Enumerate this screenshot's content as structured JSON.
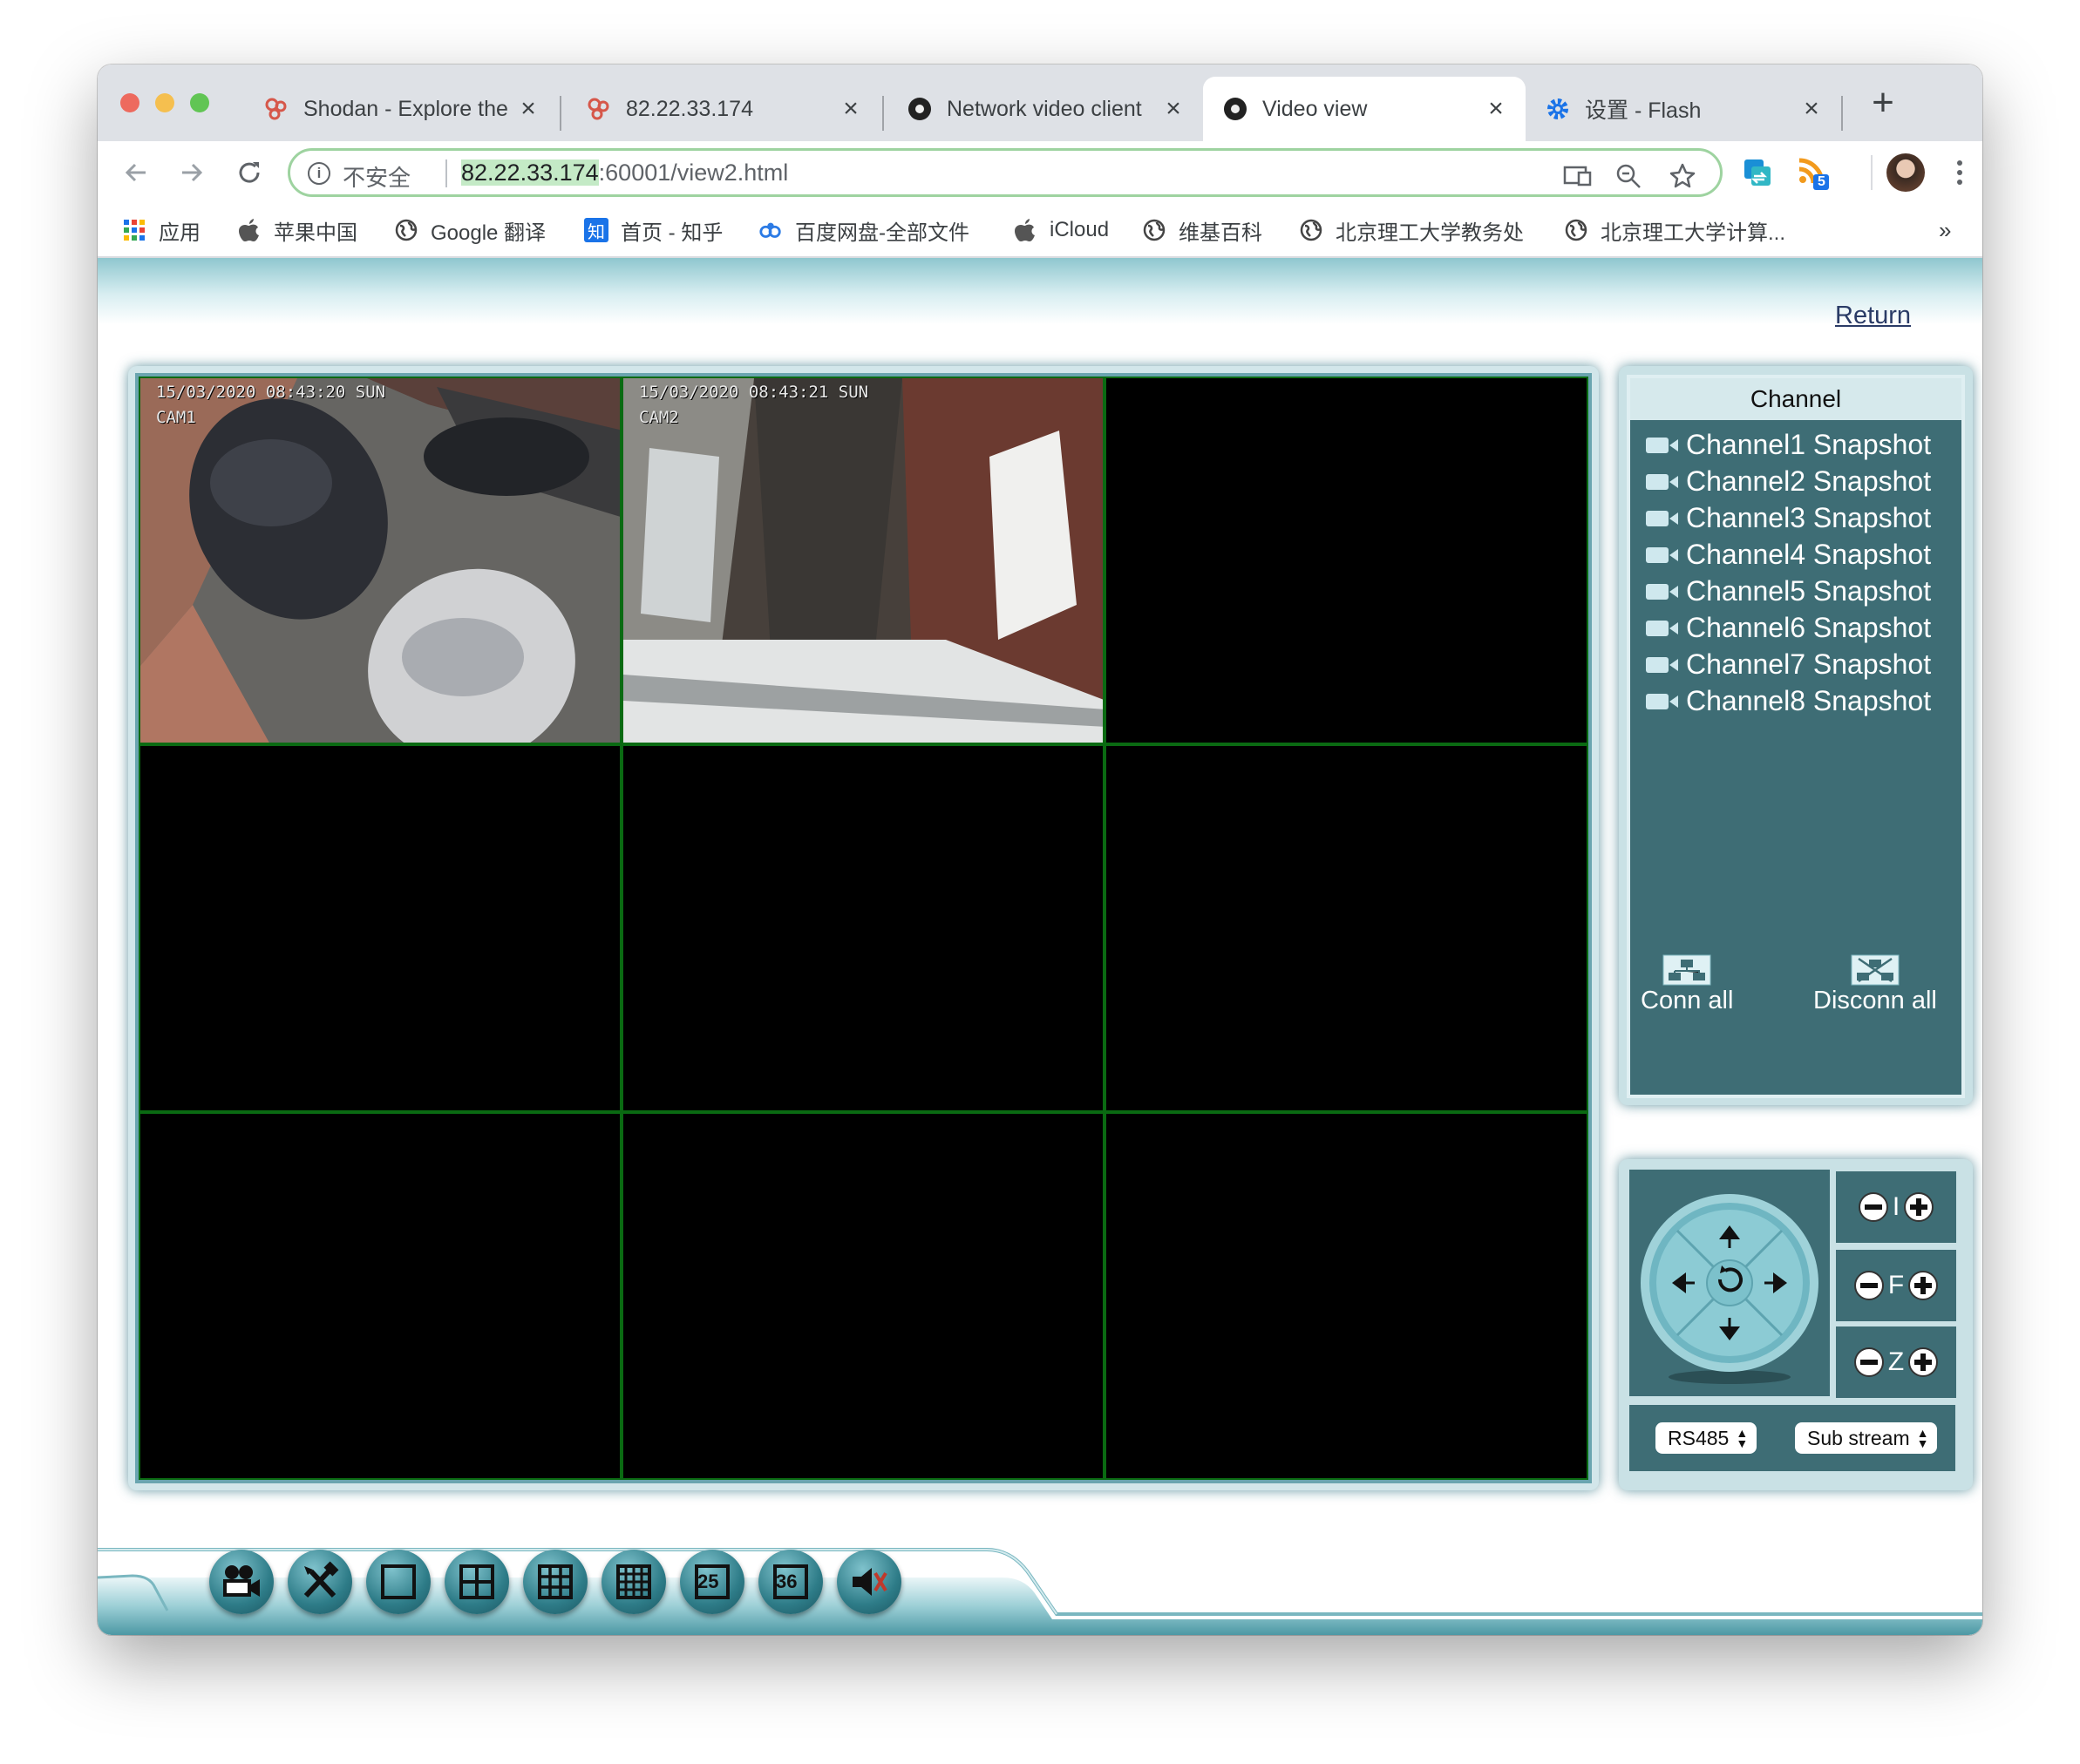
{
  "browser": {
    "tabs": [
      {
        "title": "Shodan - Explore the I",
        "icon": "shodan-icon",
        "active": false
      },
      {
        "title": "82.22.33.174",
        "icon": "shodan-icon",
        "active": false
      },
      {
        "title": "Network video client",
        "icon": "camera-app-icon",
        "active": false
      },
      {
        "title": "Video view",
        "icon": "camera-app-icon",
        "active": true
      },
      {
        "title": "设置 - Flash",
        "icon": "gear-icon",
        "active": false
      }
    ],
    "new_tab_label": "+",
    "address": {
      "security_label": "不安全",
      "host": "82.22.33.174",
      "path": ":60001/view2.html"
    },
    "extension_badge": "5",
    "bookmarks": [
      {
        "label": "应用",
        "icon": "apps-grid-icon"
      },
      {
        "label": "苹果中国",
        "icon": "apple-icon"
      },
      {
        "label": "Google 翻译",
        "icon": "globe-icon"
      },
      {
        "label": "首页 - 知乎",
        "icon": "zhihu-icon"
      },
      {
        "label": "百度网盘-全部文件",
        "icon": "baidu-pan-icon"
      },
      {
        "label": "iCloud",
        "icon": "apple-icon"
      },
      {
        "label": "维基百科",
        "icon": "globe-icon"
      },
      {
        "label": "北京理工大学教务处",
        "icon": "globe-icon"
      },
      {
        "label": "北京理工大学计算...",
        "icon": "globe-icon"
      }
    ],
    "overflow_label": "»",
    "zhihu_glyph": "知"
  },
  "page": {
    "return_label": "Return",
    "cameras": [
      {
        "timestamp": "15/03/2020 08:43:20 SUN",
        "name": "CAM1"
      },
      {
        "timestamp": "15/03/2020 08:43:21 SUN",
        "name": "CAM2"
      }
    ],
    "channel_panel": {
      "title": "Channel",
      "items": [
        "Channel1 Snapshot",
        "Channel2 Snapshot",
        "Channel3 Snapshot",
        "Channel4 Snapshot",
        "Channel5 Snapshot",
        "Channel6 Snapshot",
        "Channel7 Snapshot",
        "Channel8 Snapshot"
      ],
      "conn_all": "Conn all",
      "disconn_all": "Disconn all"
    },
    "ptz": {
      "iris_label": "I",
      "focus_label": "F",
      "zoom_label": "Z",
      "protocol_select": "RS485",
      "stream_select": "Sub stream"
    },
    "bottom_toolbar": {
      "grid25_label": "25",
      "grid36_label": "36"
    }
  },
  "colors": {
    "panel_teal": "#3e6d75",
    "grid_line_green": "#0a6a12",
    "address_highlight": "#c4eac6"
  }
}
